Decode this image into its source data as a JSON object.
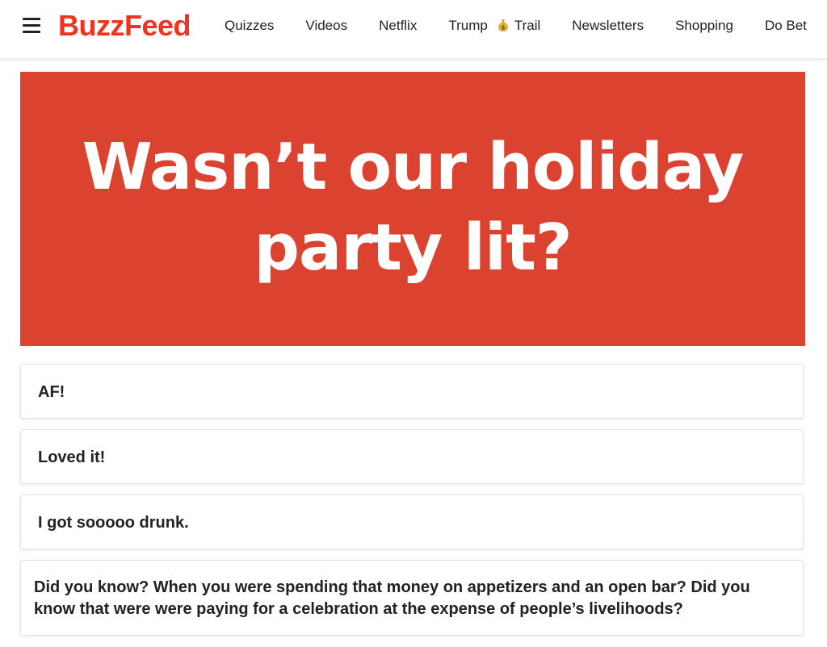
{
  "colors": {
    "brand": "#ee3322",
    "hero_background": "#db4330",
    "hero_text": "#ffffff",
    "text": "#222222",
    "card_border": "#e3e3e3"
  },
  "header": {
    "menu_icon": "hamburger-menu-icon",
    "logo_text": "BuzzFeed",
    "nav": [
      {
        "label": "Quizzes"
      },
      {
        "label": "Videos"
      },
      {
        "label": "Netflix"
      },
      {
        "label": "Trump",
        "icon": "money-bag-icon",
        "label_suffix": "Trail"
      },
      {
        "label": "Newsletters"
      },
      {
        "label": "Shopping"
      },
      {
        "label": "Do Bet"
      }
    ]
  },
  "quiz": {
    "question_line1": "Wasn’t our holiday",
    "question_line2": "party lit?",
    "answers": [
      {
        "label": "AF!"
      },
      {
        "label": "Loved it!"
      },
      {
        "label": "I got sooooo drunk."
      },
      {
        "label": "Did you know? When you were spending that money on appetizers and an open bar? Did you know that were were paying for a celebration at the expense of people’s livelihoods?"
      }
    ]
  }
}
